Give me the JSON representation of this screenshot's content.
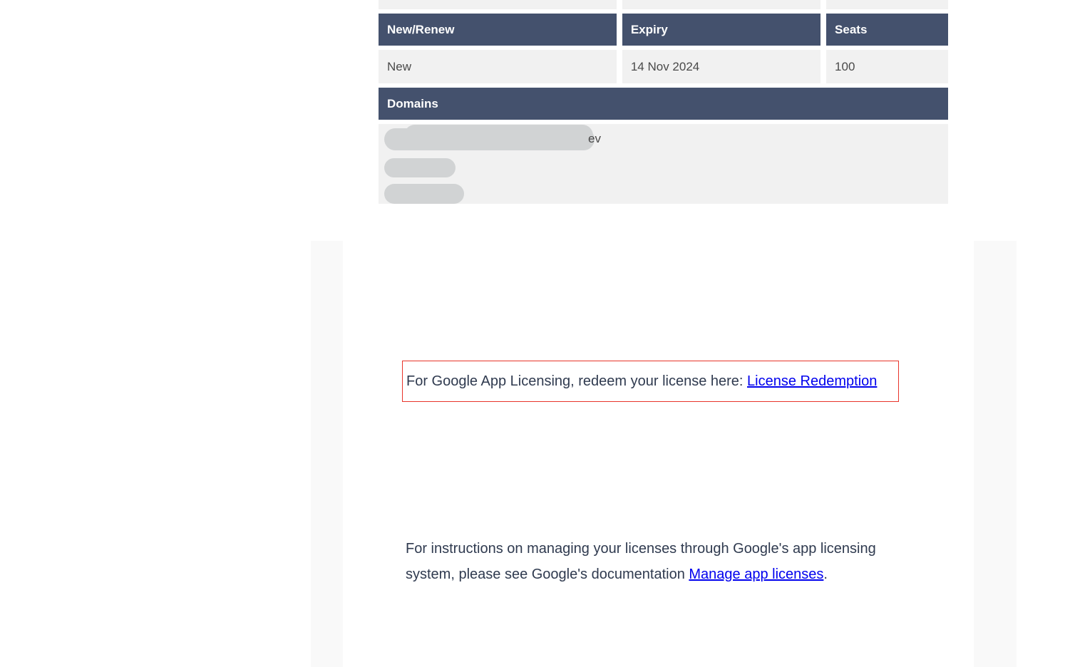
{
  "license_table": {
    "header_row": {
      "new_renew_label": "New/Renew",
      "expiry_label": "Expiry",
      "seats_label": "Seats"
    },
    "data_row": {
      "new_renew_value": "New",
      "expiry_value": "14 Nov 2024",
      "seats_value": "100"
    },
    "domains_header_label": "Domains",
    "domains_visible_text": "ev"
  },
  "callout": {
    "text_before_link": "For Google App Licensing, redeem your license here: ",
    "link_label": "License Redemption"
  },
  "instructions": {
    "text_before_link": "For instructions on managing your licenses through Google's app licensing system, please see Google's documentation ",
    "link_label": "Manage app licenses",
    "text_after_link": "."
  }
}
